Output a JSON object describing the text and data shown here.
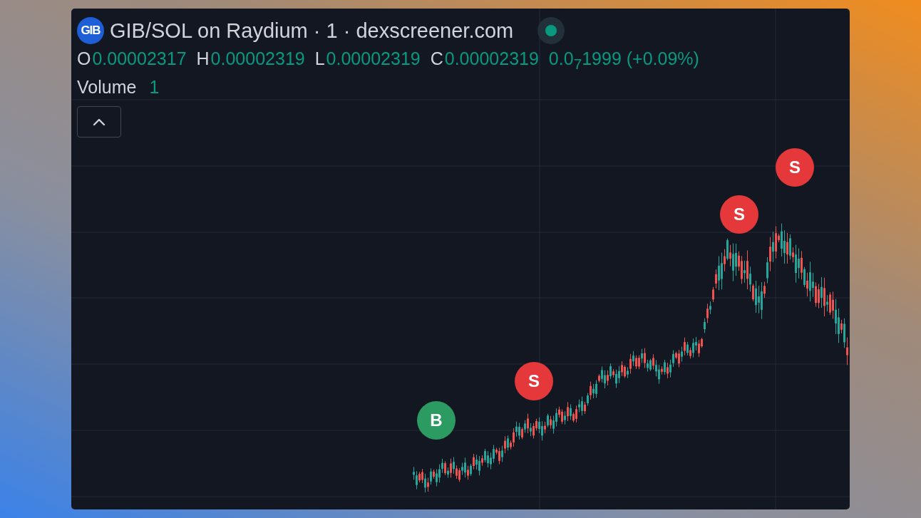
{
  "header": {
    "logo": "GIB",
    "title": "GIB/SOL on Raydium · 1 · dexscreener.com"
  },
  "ohlc": [
    {
      "label": "O",
      "value": "0.00002317"
    },
    {
      "label": "H",
      "value": "0.00002319"
    },
    {
      "label": "L",
      "value": "0.00002319"
    },
    {
      "label": "C",
      "value": "0.00002319"
    }
  ],
  "change": "0.0$_{7}$1999 (+0.09%)",
  "volume": {
    "label": "Volume",
    "value": "1"
  },
  "markers": [
    {
      "kind": "buy",
      "label": "B"
    },
    {
      "kind": "sell",
      "label": "S"
    },
    {
      "kind": "sell",
      "label": "S"
    },
    {
      "kind": "sell",
      "label": "S"
    }
  ]
}
